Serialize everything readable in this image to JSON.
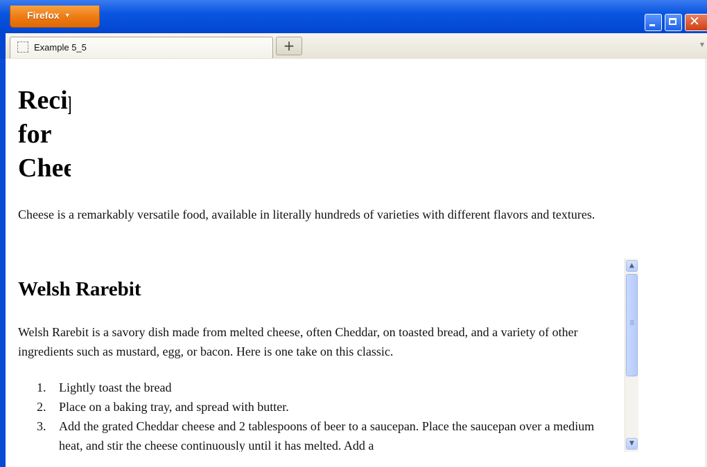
{
  "window": {
    "app_button_label": "Firefox",
    "controls": [
      "minimize",
      "maximize",
      "close"
    ]
  },
  "tabs": [
    {
      "title": "Example 5_5",
      "active": true
    }
  ],
  "tab_new_label": "+",
  "page": {
    "heading_lines": [
      "Recipes",
      "for",
      "Cheese"
    ],
    "intro": "Cheese is a remarkably versatile food, available in literally hundreds of varieties with different flavors and textures.",
    "article": {
      "title": "Welsh Rarebit",
      "description": "Welsh Rarebit is a savory dish made from melted cheese, often Cheddar, on toasted bread, and a variety of other ingredients such as mustard, egg, or bacon. Here is one take on this classic.",
      "steps": [
        {
          "num": "1.",
          "text": "Lightly toast the bread"
        },
        {
          "num": "2.",
          "text": "Place on a baking tray, and spread with butter."
        },
        {
          "num": "3.",
          "text": "Add the grated Cheddar cheese and 2 tablespoons of beer to a saucepan. Place the saucepan over a medium heat, and stir the cheese continuously until it has melted. Add a"
        }
      ]
    }
  },
  "colors": {
    "titlebar": "#0245d1",
    "firefox_button": "#ee7a12",
    "scroll_thumb": "#b6cbfb"
  }
}
